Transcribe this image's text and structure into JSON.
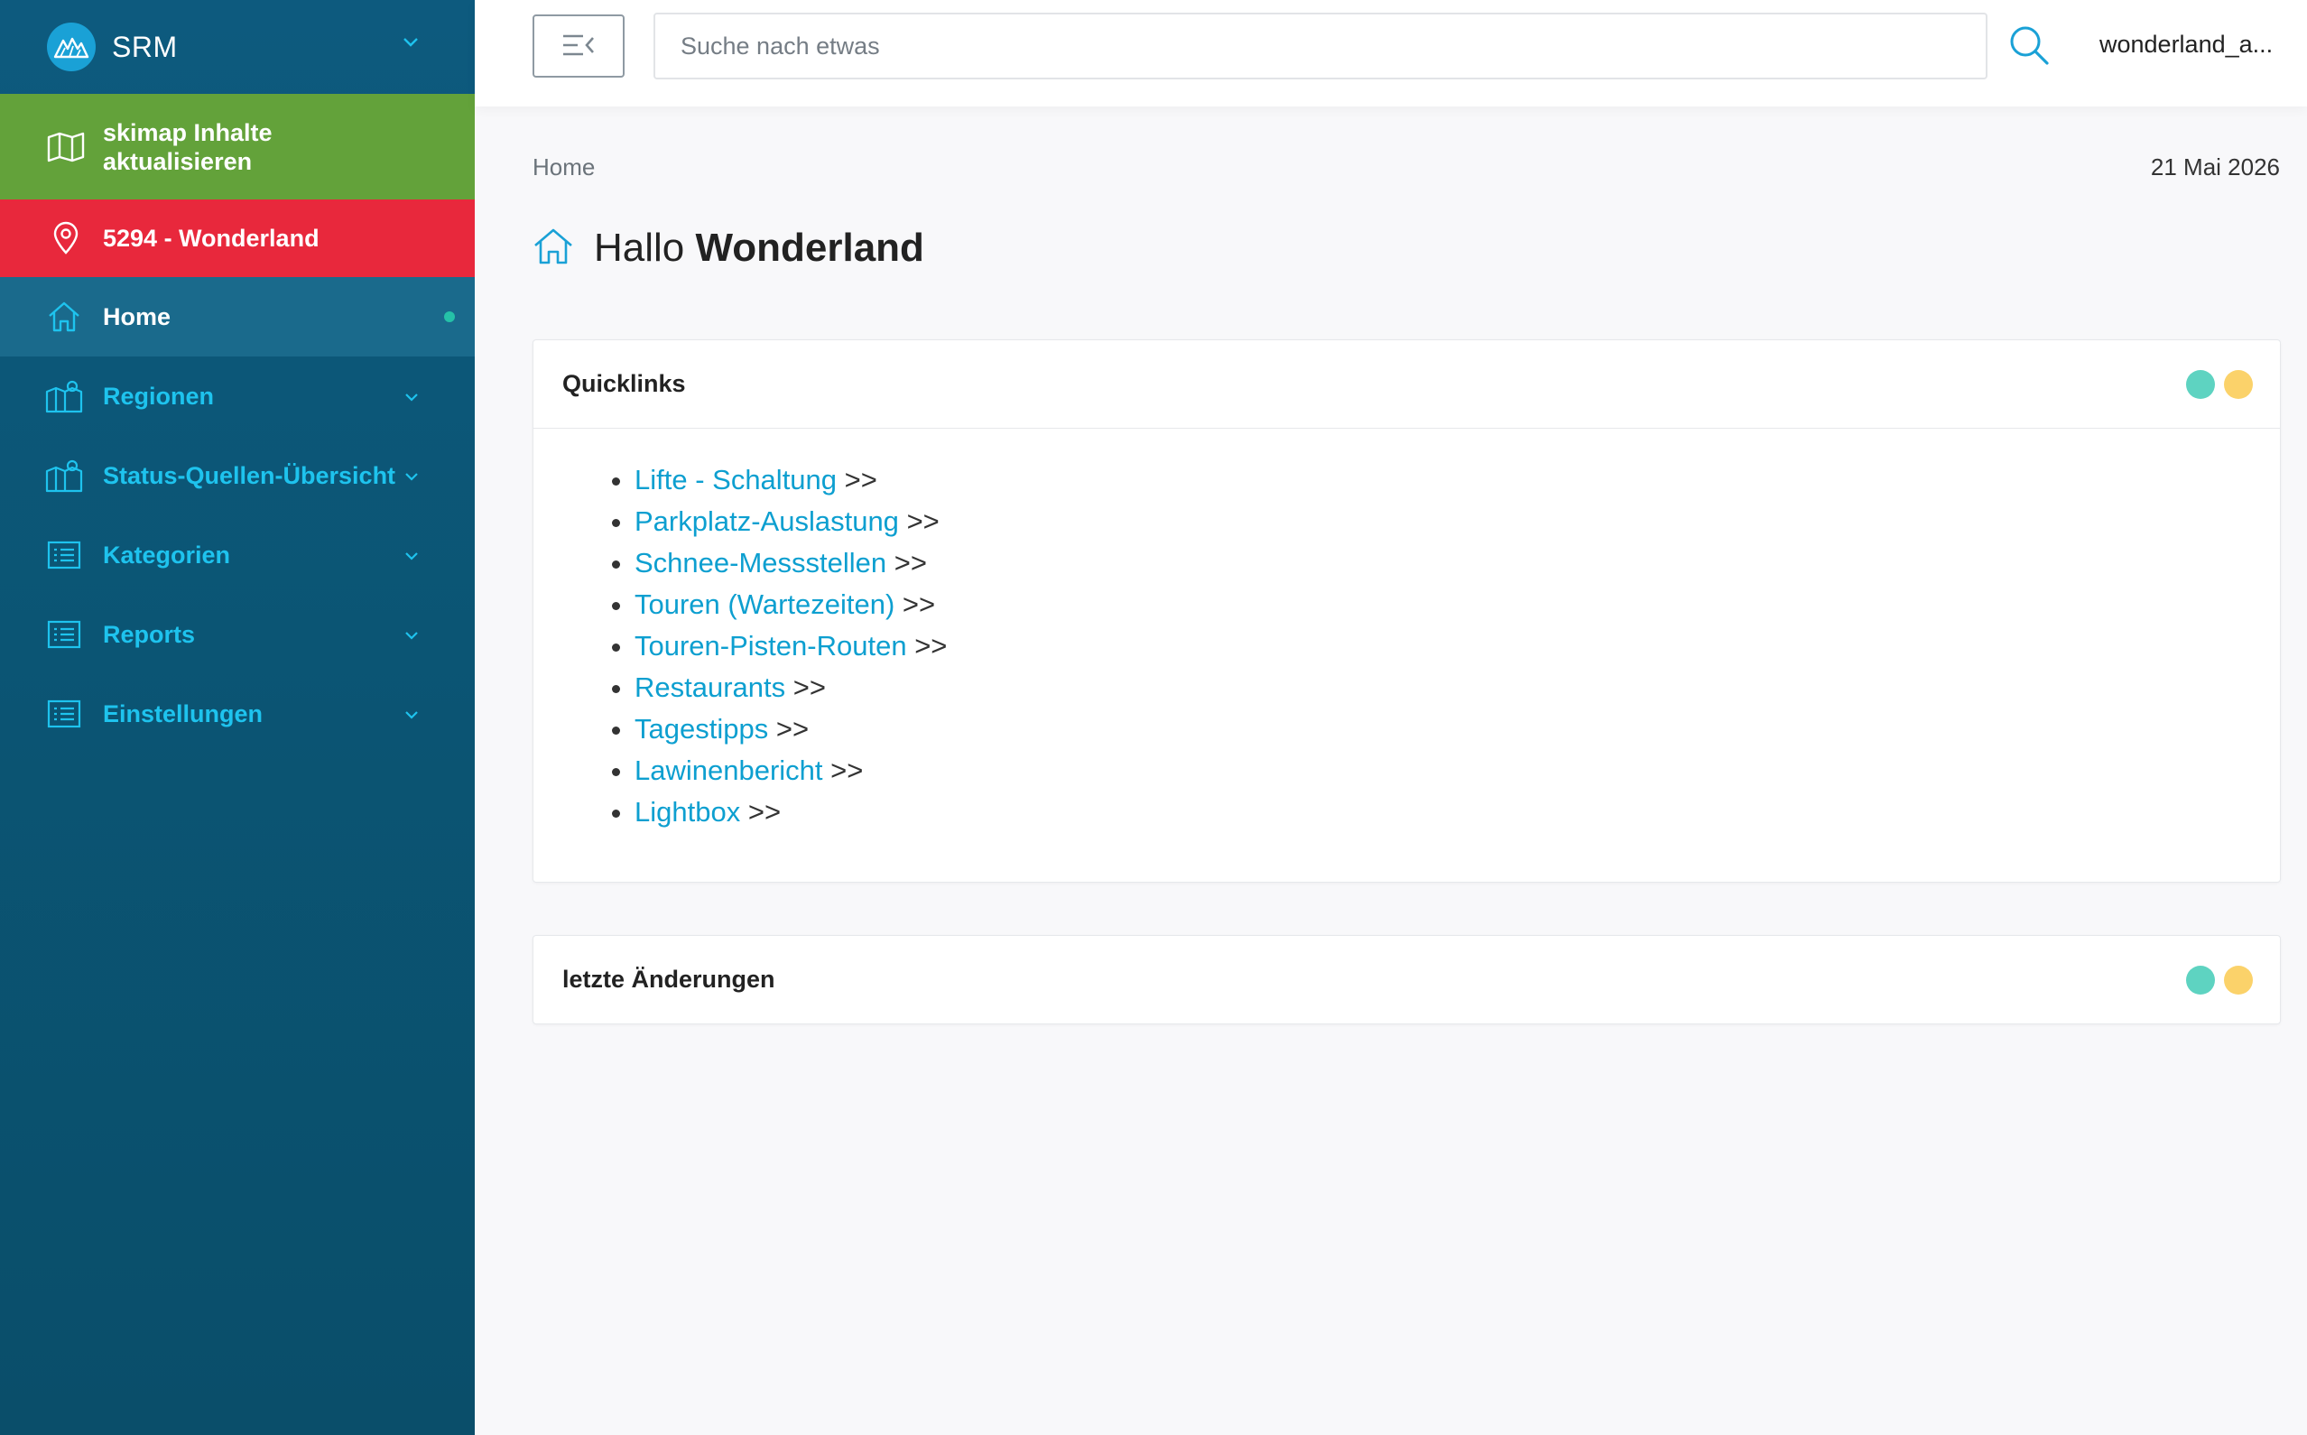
{
  "brand": {
    "name": "SRM"
  },
  "banners": {
    "update_label": "skimap Inhalte aktualisieren",
    "location_label": "5294 - Wonderland"
  },
  "nav": {
    "items": [
      {
        "label": "Home",
        "icon": "home-icon",
        "active": true
      },
      {
        "label": "Regionen",
        "icon": "map-regions-icon"
      },
      {
        "label": "Status-Quellen-Übersicht",
        "icon": "map-regions-icon"
      },
      {
        "label": "Kategorien",
        "icon": "list-icon"
      },
      {
        "label": "Reports",
        "icon": "list-icon"
      },
      {
        "label": "Einstellungen",
        "icon": "list-icon"
      }
    ]
  },
  "topbar": {
    "search_placeholder": "Suche nach etwas",
    "username": "wonderland_a..."
  },
  "main": {
    "breadcrumb": "Home",
    "date": "21 Mai 2026",
    "greeting": "Hallo",
    "greeting_name": "Wonderland"
  },
  "quicklinks_card": {
    "title": "Quicklinks",
    "arrow": ">>",
    "links": [
      "Lifte - Schaltung",
      "Parkplatz-Auslastung",
      "Schnee-Messstellen",
      "Touren (Wartezeiten)",
      "Touren-Pisten-Routen",
      "Restaurants",
      "Tagestipps",
      "Lawinenbericht",
      "Lightbox"
    ]
  },
  "changes_card": {
    "title": "letzte Änderungen"
  },
  "colors": {
    "sidebar": "#0b5574",
    "accent": "#1ec3ee",
    "green_banner": "#63a23a",
    "red_banner": "#e8283c",
    "link": "#0d9fd0",
    "dot_teal": "#5ed3c1",
    "dot_yellow": "#fbd26a"
  }
}
